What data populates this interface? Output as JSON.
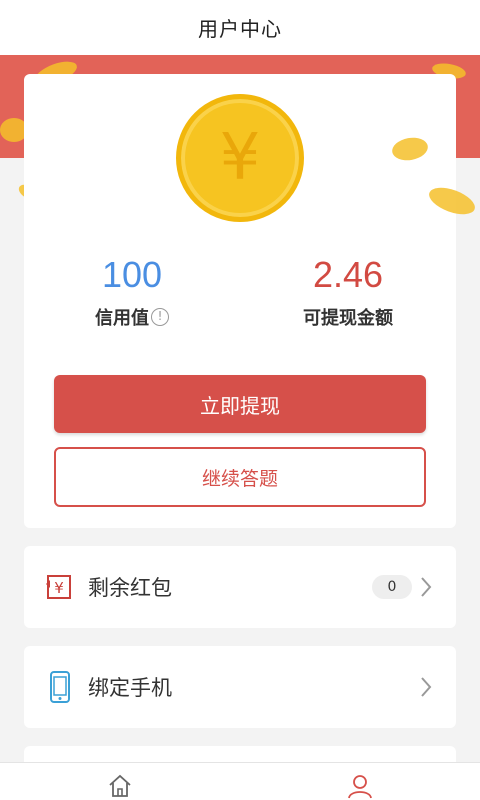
{
  "header": {
    "title": "用户中心"
  },
  "stats": {
    "credit": {
      "value": "100",
      "label": "信用值",
      "info_glyph": "!"
    },
    "withdrawable": {
      "value": "2.46",
      "label": "可提现金额"
    }
  },
  "coin_symbol": "¥",
  "buttons": {
    "withdraw": "立即提现",
    "continue": "继续答题"
  },
  "rows": [
    {
      "label": "剩余红包",
      "badge": "0",
      "icon": "red-envelope-yuan-icon"
    },
    {
      "label": "绑定手机",
      "icon": "phone-icon"
    }
  ],
  "tabs": [
    {
      "icon": "home-icon",
      "active": false
    },
    {
      "icon": "user-icon",
      "active": true
    }
  ],
  "colors": {
    "accent_red": "#d6504a",
    "credit_blue": "#4a8ee2",
    "band_red": "#e26358",
    "coin_gold": "#f6c421"
  }
}
